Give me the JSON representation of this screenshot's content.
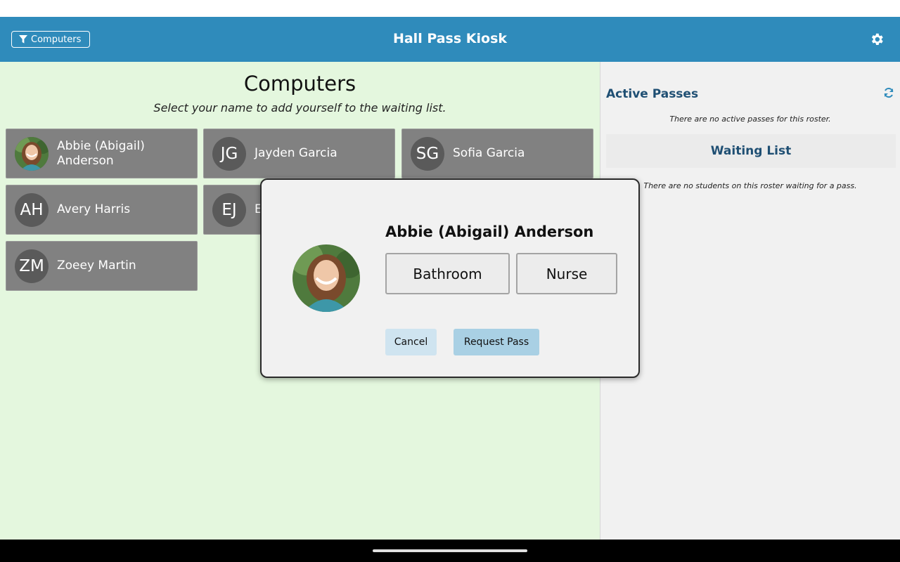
{
  "header": {
    "filter_label": "Computers",
    "title": "Hall Pass Kiosk",
    "settings_icon": "gear-icon",
    "filter_icon": "funnel-icon"
  },
  "roster": {
    "title": "Computers",
    "subtitle": "Select your name to add yourself to the waiting list.",
    "students": [
      {
        "initials": "",
        "name": "Abbie (Abigail) Anderson",
        "has_photo": true
      },
      {
        "initials": "JG",
        "name": "Jayden Garcia"
      },
      {
        "initials": "SG",
        "name": "Sofia Garcia"
      },
      {
        "initials": "AH",
        "name": "Avery Harris"
      },
      {
        "initials": "EJ",
        "name": "E"
      },
      {
        "initials": "ZM",
        "name": "Zoeey Martin"
      }
    ]
  },
  "sidebar": {
    "active_title": "Active Passes",
    "active_empty": "There are no active passes for this roster.",
    "waiting_title": "Waiting List",
    "waiting_empty": "There are no students on this roster waiting for a pass.",
    "refresh_icon": "refresh-icon"
  },
  "modal": {
    "student_name": "Abbie (Abigail) Anderson",
    "destinations": [
      "Bathroom",
      "Nurse"
    ],
    "cancel_label": "Cancel",
    "request_label": "Request Pass"
  },
  "colors": {
    "header": "#2f8bbb",
    "roster_bg": "#e4f7de",
    "card": "#818181",
    "avatar": "#5a5a5a",
    "section_title": "#1f4f73",
    "cancel_btn": "#cfe4f0",
    "request_btn": "#a9d0e4"
  }
}
